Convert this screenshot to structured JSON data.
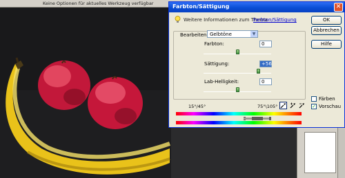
{
  "options_bar": {
    "hint": "Keine Optionen für aktuelles Werkzeug verfügbar"
  },
  "dialog": {
    "title": "Farbton/Sättigung",
    "close_glyph": "✕",
    "info_text": "Weitere Informationen zum Thema",
    "info_link": "Farbton/Sättigung",
    "buttons": {
      "ok": "OK",
      "cancel": "Abbrechen",
      "help": "Hilfe"
    },
    "edit": {
      "label": "Bearbeiten:",
      "value": "Gelbtöne",
      "arrow": "▼"
    },
    "hue": {
      "label": "Farbton:",
      "value": "0"
    },
    "saturation": {
      "label": "Sättigung:",
      "value": "+56"
    },
    "lightness": {
      "label": "Lab-Helligkeit:",
      "value": "0"
    },
    "range_left": "15°/45°",
    "range_right": "75°\\105°",
    "colorize": {
      "label": "Färben",
      "checked": false
    },
    "preview": {
      "label": "Vorschau",
      "checked": true,
      "mark": "✓"
    },
    "icons": [
      "bulb-icon",
      "eyedropper-icon",
      "eyedropper-plus-icon",
      "eyedropper-minus-icon"
    ]
  },
  "colors": {
    "title_bar": "#0a4fd6",
    "dialog_bg": "#ece9d8",
    "link": "#0000cc",
    "slider_thumb": "#3f8f3f",
    "canvas_bg": "#19191b"
  }
}
